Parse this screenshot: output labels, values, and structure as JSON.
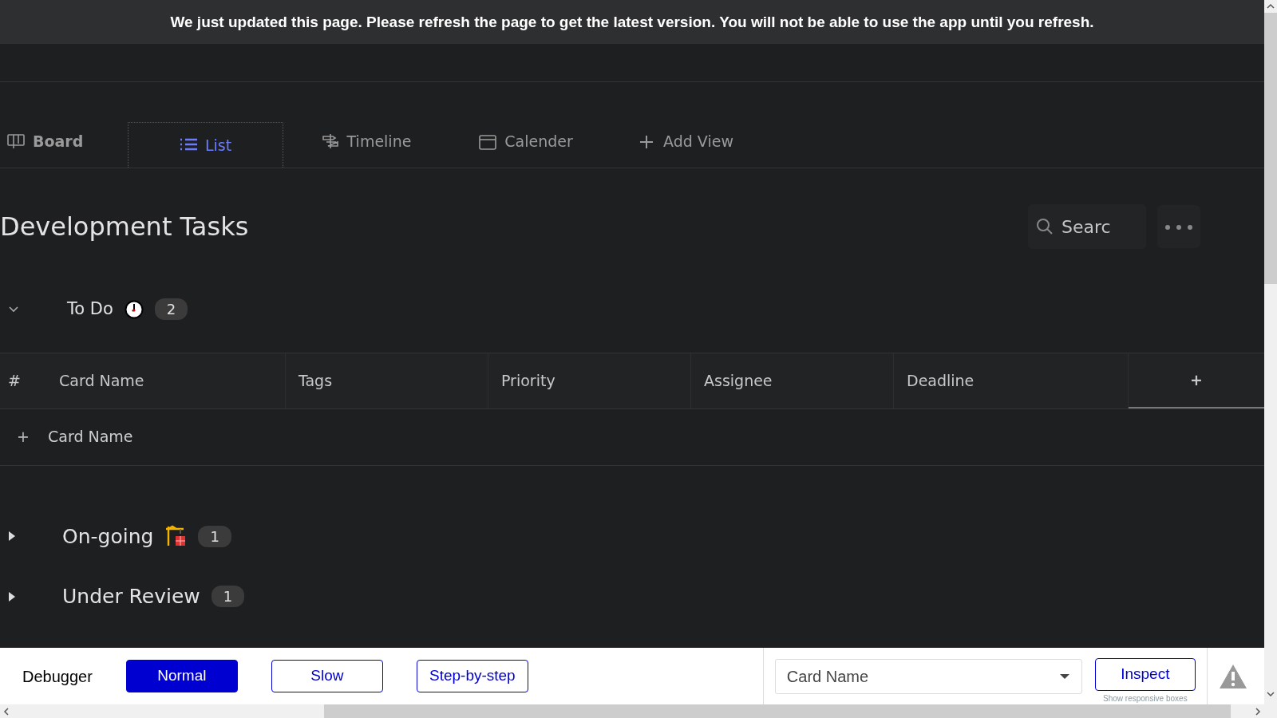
{
  "banner": "We just updated this page. Please refresh the page to get the latest version. You will not be able to use the app until you refresh.",
  "tabs": [
    {
      "label": "Board",
      "selected": false
    },
    {
      "label": "List",
      "selected": true
    },
    {
      "label": "Timeline",
      "selected": false
    },
    {
      "label": "Calender",
      "selected": false
    },
    {
      "label": "Add View",
      "selected": false
    }
  ],
  "page_title": "Development Tasks",
  "search": {
    "placeholder": "Searc"
  },
  "groups": [
    {
      "name": "To Do",
      "count": "2",
      "expanded": true,
      "table": {
        "columns": [
          "#",
          "Card Name",
          "Tags",
          "Priority",
          "Assignee",
          "Deadline",
          "+"
        ],
        "add_row": {
          "icon": "+",
          "placeholder": "Card Name"
        }
      }
    },
    {
      "name": "On-going",
      "count": "1",
      "expanded": false
    },
    {
      "name": "Under Review",
      "count": "1",
      "expanded": false
    }
  ],
  "debugger": {
    "label": "Debugger",
    "modes": [
      {
        "label": "Normal",
        "selected": true
      },
      {
        "label": "Slow",
        "selected": false
      },
      {
        "label": "Step-by-step",
        "selected": false
      }
    ],
    "select": {
      "value": "Card Name"
    },
    "inspect": "Inspect",
    "inspect_hint": "Show responsive boxes"
  }
}
